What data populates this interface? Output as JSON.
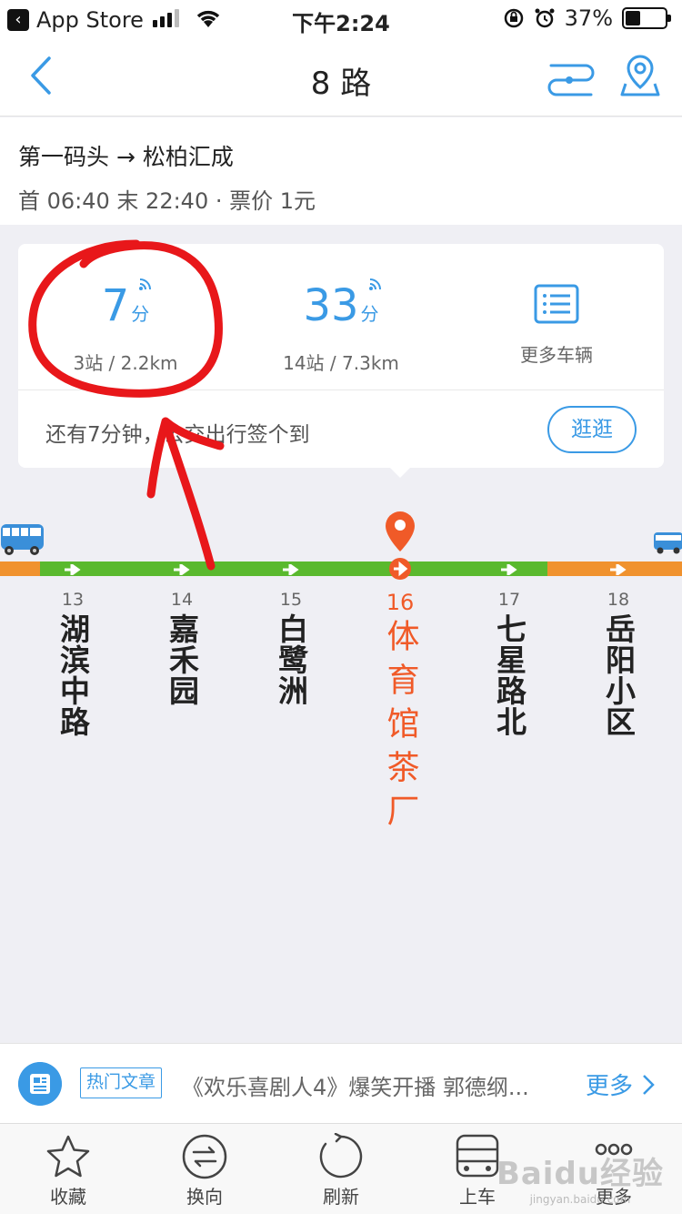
{
  "status_bar": {
    "back_app": "App Store",
    "time": "下午2:24",
    "battery": "37%",
    "battery_level": 0.37
  },
  "navbar": {
    "title": "8 路"
  },
  "route": {
    "direction": "第一码头 → 松柏汇成",
    "schedule": "首 06:40 末 22:40 · 票价 1元"
  },
  "arrivals": [
    {
      "minutes": "7",
      "unit": "分",
      "detail": "3站 / 2.2km"
    },
    {
      "minutes": "33",
      "unit": "分",
      "detail": "14站 / 7.3km"
    }
  ],
  "more_vehicles": "更多车辆",
  "notice": "还有7分钟，公交出行签个到",
  "stroll_button": "逛逛",
  "stops": [
    {
      "num": "13",
      "name": "湖滨中路"
    },
    {
      "num": "14",
      "name": "嘉禾园"
    },
    {
      "num": "15",
      "name": "白鹭洲"
    },
    {
      "num": "16",
      "name": "体育馆茶厂",
      "current": true
    },
    {
      "num": "17",
      "name": "七星路北"
    },
    {
      "num": "18",
      "name": "岳阳小区"
    }
  ],
  "colors": {
    "accent": "#3a9ae5",
    "current_stop": "#f05a28",
    "track_green": "#5ab92e",
    "track_orange": "#f0922e",
    "annotation": "#e8171a"
  },
  "news": {
    "tag": "热门文章",
    "headline": "《欢乐喜剧人4》爆笑开播 郭德纲...",
    "more": "更多"
  },
  "tabbar": {
    "items": [
      {
        "label": "收藏",
        "icon": "star-icon"
      },
      {
        "label": "换向",
        "icon": "swap-icon"
      },
      {
        "label": "刷新",
        "icon": "refresh-icon"
      },
      {
        "label": "上车",
        "icon": "bus-icon"
      },
      {
        "label": "更多",
        "icon": "more-icon"
      }
    ]
  },
  "watermark": {
    "text": "Baidu经验",
    "url": "jingyan.baidu.com"
  }
}
